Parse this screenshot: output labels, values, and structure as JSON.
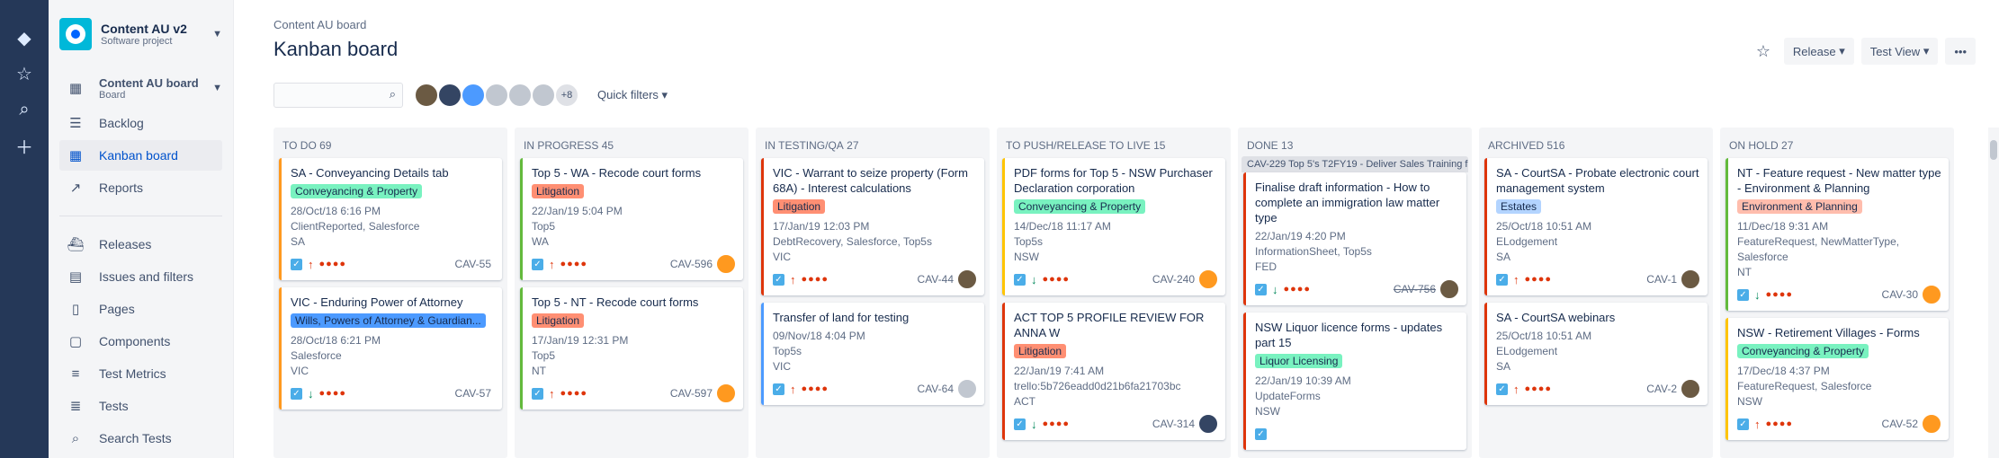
{
  "sidebar": {
    "project": {
      "name": "Content AU v2",
      "type": "Software project"
    },
    "board": {
      "name": "Content AU board",
      "type": "Board"
    },
    "nav_top": [
      {
        "label": "Backlog",
        "icon": "backlog-icon"
      },
      {
        "label": "Kanban board",
        "icon": "board-icon",
        "active": true
      },
      {
        "label": "Reports",
        "icon": "reports-icon"
      }
    ],
    "nav_bottom": [
      {
        "label": "Releases",
        "icon": "ship-icon"
      },
      {
        "label": "Issues and filters",
        "icon": "issues-icon"
      },
      {
        "label": "Pages",
        "icon": "page-icon"
      },
      {
        "label": "Components",
        "icon": "component-icon"
      },
      {
        "label": "Test Metrics",
        "icon": "metrics-icon"
      },
      {
        "label": "Tests",
        "icon": "tests-icon"
      },
      {
        "label": "Search Tests",
        "icon": "search-tests-icon"
      }
    ]
  },
  "header": {
    "breadcrumb": "Content AU board",
    "title": "Kanban board",
    "release_label": "Release",
    "view_label": "Test View",
    "more_label": "•••"
  },
  "filters": {
    "search_placeholder": "",
    "more_people": "+8",
    "quick_filters": "Quick filters"
  },
  "columns": [
    {
      "title": "TO DO",
      "count": "69",
      "cards": [
        {
          "summary": "SA - Conveyancing Details tab",
          "label": "Conveyancing & Property",
          "label_color": "#79f2c0",
          "date": "28/Oct/18 6:16 PM",
          "tags": "ClientReported, Salesforce",
          "state": "SA",
          "key": "CAV-55",
          "priority": "up",
          "border": "#ff991f",
          "avatar": ""
        },
        {
          "summary": "VIC - Enduring Power of Attorney",
          "label": "Wills, Powers of Attorney & Guardian...",
          "label_color": "#4c9aff",
          "date": "28/Oct/18 6:21 PM",
          "tags": "Salesforce",
          "state": "VIC",
          "key": "CAV-57",
          "priority": "down",
          "border": "#ff991f",
          "avatar": ""
        }
      ]
    },
    {
      "title": "IN PROGRESS",
      "count": "45",
      "cards": [
        {
          "summary": "Top 5 - WA - Recode court forms",
          "label": "Litigation",
          "label_color": "#ff8f73",
          "date": "22/Jan/19 5:04 PM",
          "tags": "Top5",
          "state": "WA",
          "key": "CAV-596",
          "priority": "up",
          "border": "#63ba3c",
          "avatar": "orange"
        },
        {
          "summary": "Top 5 - NT - Recode court forms",
          "label": "Litigation",
          "label_color": "#ff8f73",
          "date": "17/Jan/19 12:31 PM",
          "tags": "Top5",
          "state": "NT",
          "key": "CAV-597",
          "priority": "up",
          "border": "#63ba3c",
          "avatar": "orange"
        }
      ]
    },
    {
      "title": "IN TESTING/QA",
      "count": "27",
      "cards": [
        {
          "summary": "VIC - Warrant to seize property (Form 68A) - Interest calculations",
          "label": "Litigation",
          "label_color": "#ff8f73",
          "date": "17/Jan/19 12:03 PM",
          "tags": "DebtRecovery, Salesforce, Top5s",
          "state": "VIC",
          "key": "CAV-44",
          "priority": "up",
          "border": "#de350b",
          "avatar": "brn"
        },
        {
          "summary": "Transfer of land for testing",
          "label": "",
          "label_color": "",
          "date": "09/Nov/18 4:04 PM",
          "tags": "Top5s",
          "state": "VIC",
          "key": "CAV-64",
          "priority": "up",
          "border": "#4c9aff",
          "avatar": "grey"
        }
      ]
    },
    {
      "title": "TO PUSH/RELEASE TO LIVE",
      "count": "15",
      "cards": [
        {
          "summary": "PDF forms for Top 5 - NSW Purchaser Declaration corporation",
          "label": "Conveyancing & Property",
          "label_color": "#79f2c0",
          "date": "14/Dec/18 11:17 AM",
          "tags": "Top5s",
          "state": "NSW",
          "key": "CAV-240",
          "priority": "down",
          "border": "#ffc400",
          "avatar": "orange"
        },
        {
          "summary": "ACT TOP 5 PROFILE REVIEW FOR ANNA W",
          "label": "Litigation",
          "label_color": "#ff8f73",
          "date": "22/Jan/19 7:41 AM",
          "tags": "trello:5b726eadd0d21b6fa21703bc",
          "state": "ACT",
          "key": "CAV-314",
          "priority": "down",
          "border": "#de350b",
          "avatar": "dark"
        }
      ]
    },
    {
      "title": "DONE",
      "count": "13",
      "swimlane": "CAV-229 Top 5's T2FY19 - Deliver Sales Training f...",
      "cards": [
        {
          "summary": "Finalise draft information - How to complete an immigration law matter type",
          "label": "",
          "label_color": "",
          "date": "22/Jan/19 4:20 PM",
          "tags": "InformationSheet, Top5s",
          "state": "FED",
          "key": "CAV-756",
          "priority": "down",
          "border": "#de350b",
          "avatar": "brn",
          "strike": true
        },
        {
          "summary": "NSW Liquor licence forms - updates part 15",
          "label": "Liquor Licensing",
          "label_color": "#79f2c0",
          "date": "22/Jan/19 10:39 AM",
          "tags": "UpdateForms",
          "state": "NSW",
          "key": "",
          "priority": "",
          "border": "#de350b",
          "avatar": ""
        }
      ]
    },
    {
      "title": "ARCHIVED",
      "count": "516",
      "cards": [
        {
          "summary": "SA - CourtSA - Probate electronic court management system",
          "label": "Estates",
          "label_color": "#b3d4ff",
          "date": "25/Oct/18 10:51 AM",
          "tags": "ELodgement",
          "state": "SA",
          "key": "CAV-1",
          "priority": "up",
          "border": "#de350b",
          "avatar": "brn"
        },
        {
          "summary": "SA - CourtSA webinars",
          "label": "",
          "label_color": "",
          "date": "25/Oct/18 10:51 AM",
          "tags": "ELodgement",
          "state": "SA",
          "key": "CAV-2",
          "priority": "up",
          "border": "#de350b",
          "avatar": "brn"
        }
      ]
    },
    {
      "title": "ON HOLD",
      "count": "27",
      "cards": [
        {
          "summary": "NT - Feature request - New matter type - Environment & Planning",
          "label": "Environment & Planning",
          "label_color": "#ffbdad",
          "date": "11/Dec/18 9:31 AM",
          "tags": "FeatureRequest, NewMatterType, Salesforce",
          "state": "NT",
          "key": "CAV-30",
          "priority": "down",
          "border": "#63ba3c",
          "avatar": "orange"
        },
        {
          "summary": "NSW - Retirement Villages - Forms",
          "label": "Conveyancing & Property",
          "label_color": "#79f2c0",
          "date": "17/Dec/18 4:37 PM",
          "tags": "FeatureRequest, Salesforce",
          "state": "NSW",
          "key": "CAV-52",
          "priority": "up",
          "border": "#ffc400",
          "avatar": "orange"
        }
      ]
    }
  ]
}
